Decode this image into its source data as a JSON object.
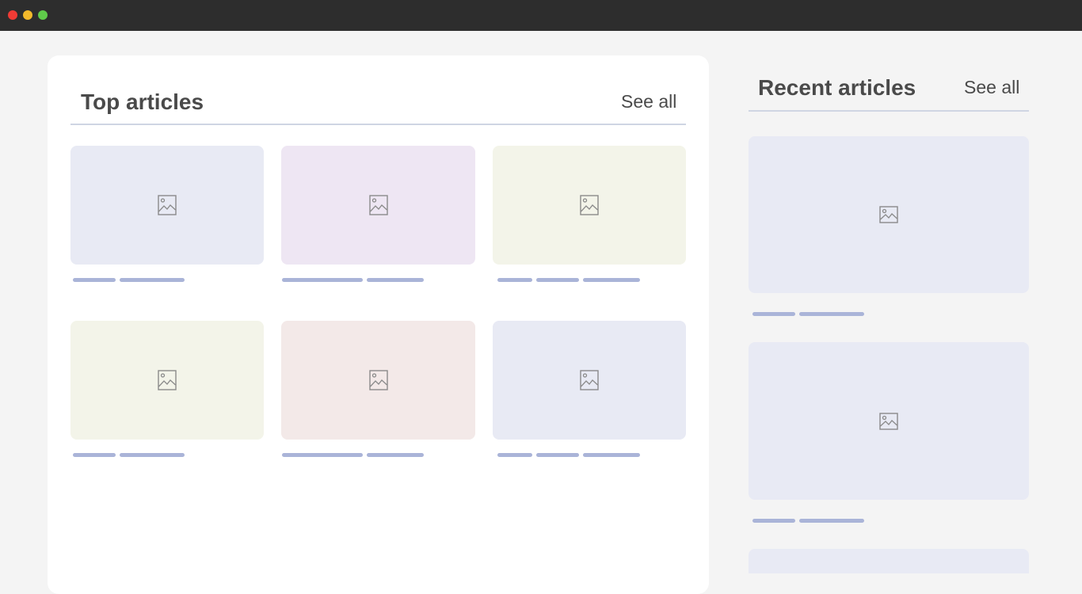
{
  "window": {
    "controls": [
      {
        "name": "close",
        "color": "#ef3b35"
      },
      {
        "name": "minimize",
        "color": "#f2b92b"
      },
      {
        "name": "zoom",
        "color": "#5fcb4a"
      }
    ]
  },
  "top_articles": {
    "title": "Top articles",
    "see_all": "See all",
    "cards": [
      {
        "thumb_color": "#e8eaf4",
        "icon": "image-icon"
      },
      {
        "thumb_color": "#eee6f3",
        "icon": "image-icon"
      },
      {
        "thumb_color": "#f3f4e9",
        "icon": "image-icon"
      },
      {
        "thumb_color": "#f3f4e9",
        "icon": "image-icon"
      },
      {
        "thumb_color": "#f3e9e8",
        "icon": "image-icon"
      },
      {
        "thumb_color": "#e8eaf4",
        "icon": "image-icon"
      }
    ]
  },
  "recent_articles": {
    "title": "Recent articles",
    "see_all": "See all",
    "cards": [
      {
        "thumb_color": "#e8eaf4",
        "icon": "image-icon"
      },
      {
        "thumb_color": "#e8eaf4",
        "icon": "image-icon"
      },
      {
        "thumb_color": "#e8eaf4",
        "icon": "image-icon"
      }
    ]
  },
  "colors": {
    "placeholder_bar": "#aab4d8",
    "divider": "#cfd5e3",
    "heading": "#4a4a4a"
  }
}
